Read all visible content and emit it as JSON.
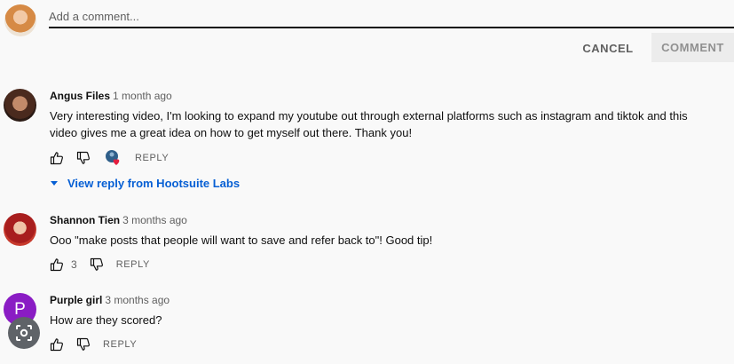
{
  "add_comment": {
    "placeholder": "Add a comment...",
    "cancel_label": "CANCEL",
    "comment_label": "COMMENT"
  },
  "comments": [
    {
      "author": "Angus Files",
      "time": "1 month ago",
      "text": "Very interesting video, I'm looking to expand my youtube out through external platforms such as instagram and tiktok and this video gives me a great idea on how to get myself out there. Thank you!",
      "likes": "",
      "reply_label": "REPLY",
      "view_reply": "View reply from Hootsuite Labs"
    },
    {
      "author": "Shannon Tien",
      "time": "3 months ago",
      "text": "Ooo \"make posts that people will want to save and refer back to\"! Good tip!",
      "likes": "3",
      "reply_label": "REPLY"
    },
    {
      "author": "Purple girl",
      "time": "3 months ago",
      "text": "How are they scored?",
      "avatar_letter": "P",
      "likes": "",
      "reply_label": "REPLY"
    }
  ],
  "colors": {
    "link": "#065fd4",
    "purple_avatar": "#8a1cc4",
    "heart": "#e41e3f"
  },
  "icons": [
    "thumb-up-icon",
    "thumb-down-icon",
    "creator-heart-icon",
    "caret-down-icon",
    "lens-search-icon"
  ]
}
